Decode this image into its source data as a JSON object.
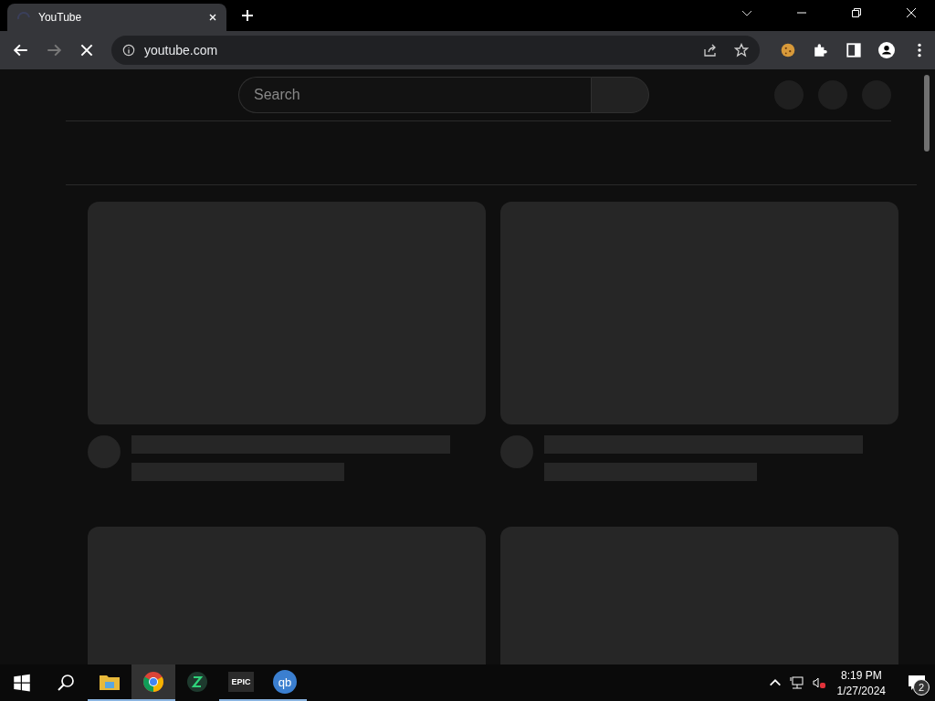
{
  "tab": {
    "title": "YouTube",
    "loading": true
  },
  "address_bar": {
    "url": "youtube.com"
  },
  "page": {
    "search": {
      "placeholder": "Search"
    },
    "cards": [
      {
        "kind": "video"
      },
      {
        "kind": "video"
      },
      {
        "kind": "thumbnail"
      },
      {
        "kind": "thumbnail"
      }
    ]
  },
  "taskbar": {
    "apps": [
      {
        "kind": "explorer",
        "running": true,
        "selected": false
      },
      {
        "kind": "chrome",
        "running": true,
        "selected": true
      },
      {
        "kind": "green",
        "running": false,
        "selected": false
      },
      {
        "kind": "epic",
        "label": "EPIC",
        "running": true,
        "selected": false
      },
      {
        "kind": "qb",
        "label": "qb",
        "running": true,
        "selected": false
      }
    ],
    "time": "8:19 PM",
    "date": "1/27/2024",
    "notifications": "2"
  }
}
